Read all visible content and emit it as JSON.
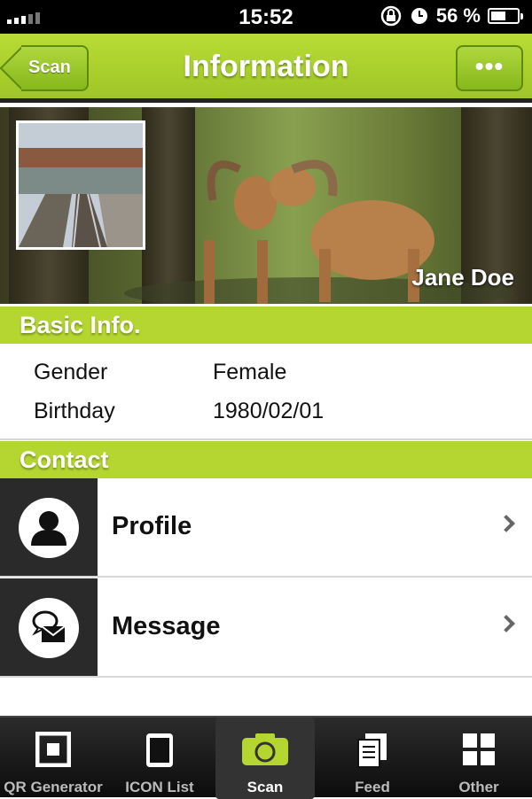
{
  "status": {
    "time": "15:52",
    "battery": "56 %",
    "battery_level": 0.56
  },
  "navbar": {
    "title": "Information",
    "back_label": "Scan",
    "more_label": "•••"
  },
  "cover": {
    "name": "Jane Doe"
  },
  "basic_info": {
    "header": "Basic Info.",
    "rows": [
      {
        "label": "Gender",
        "value": "Female"
      },
      {
        "label": "Birthday",
        "value": "1980/02/01"
      }
    ]
  },
  "contact": {
    "header": "Contact",
    "items": [
      {
        "label": "Profile",
        "icon": "person-icon"
      },
      {
        "label": "Message",
        "icon": "message-icon"
      }
    ]
  },
  "tabbar": {
    "tabs": [
      {
        "label": "QR Generator",
        "icon": "qr-icon"
      },
      {
        "label": "ICON List",
        "icon": "phone-icon"
      },
      {
        "label": "Scan",
        "icon": "camera-icon",
        "active": true
      },
      {
        "label": "Feed",
        "icon": "documents-icon"
      },
      {
        "label": "Other",
        "icon": "grid-icon"
      }
    ]
  },
  "colors": {
    "accent": "#b5d630",
    "dark": "#2a2a2a"
  }
}
